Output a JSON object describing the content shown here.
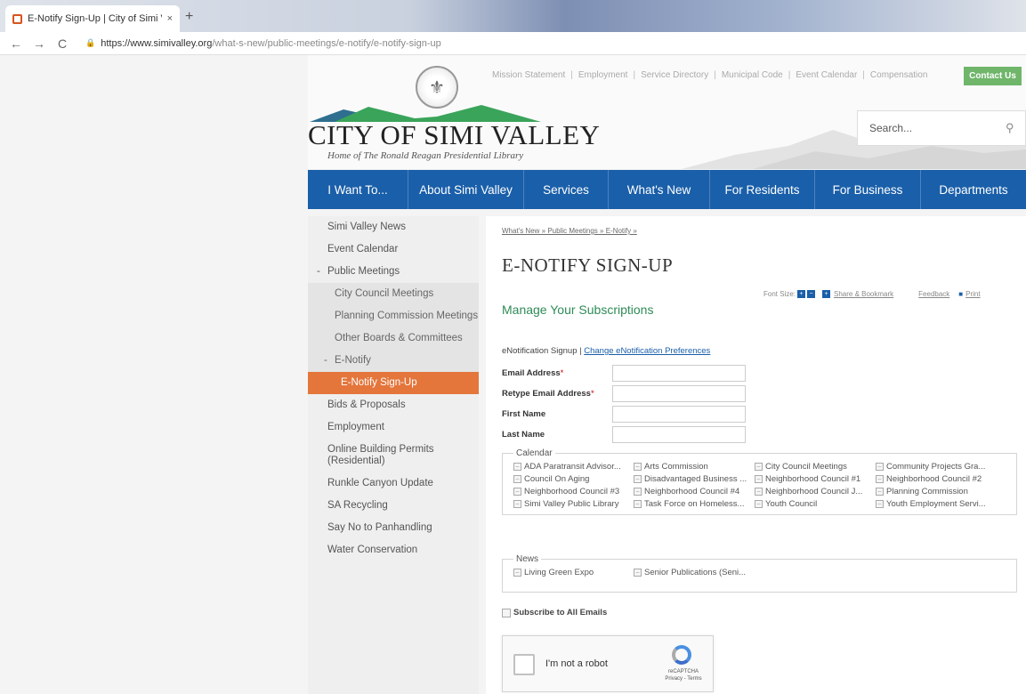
{
  "browser": {
    "tab_title": "E-Notify Sign-Up | City of Simi Va",
    "tab_close": "×",
    "new_tab": "+",
    "back": "←",
    "forward": "→",
    "reload": "C",
    "url_host": "https://www.simivalley.org",
    "url_path": "/what-s-new/public-meetings/e-notify/e-notify-sign-up"
  },
  "header": {
    "title": "CITY OF SIMI VALLEY",
    "tagline": "Home of The Ronald Reagan Presidential Library",
    "utility_links": [
      "Mission Statement",
      "Employment",
      "Service Directory",
      "Municipal Code",
      "Event Calendar",
      "Compensation"
    ],
    "contact_label": "Contact Us",
    "search_placeholder": "Search..."
  },
  "nav": {
    "items": [
      "I Want To...",
      "About Simi Valley",
      "Services",
      "What's New",
      "For Residents",
      "For Business",
      "Departments"
    ]
  },
  "sidebar": {
    "items": [
      {
        "label": "Simi Valley News"
      },
      {
        "label": "Event Calendar"
      },
      {
        "label": "Public Meetings"
      },
      {
        "label": "City Council Meetings"
      },
      {
        "label": "Planning Commission Meetings"
      },
      {
        "label": "Other Boards & Committees"
      },
      {
        "label": "E-Notify"
      },
      {
        "label": "E-Notify Sign-Up"
      },
      {
        "label": "Bids & Proposals"
      },
      {
        "label": "Employment"
      },
      {
        "label": "Online Building Permits (Residential)"
      },
      {
        "label": "Runkle Canyon Update"
      },
      {
        "label": "SA Recycling"
      },
      {
        "label": "Say No to Panhandling"
      },
      {
        "label": "Water Conservation"
      }
    ]
  },
  "content": {
    "breadcrumb": "What's New » Public Meetings » E-Notify »",
    "title": "E-NOTIFY SIGN-UP",
    "font_size_label": "Font Size:",
    "share_label": "Share & Bookmark",
    "feedback_label": "Feedback",
    "print_label": "Print",
    "subheading": "Manage Your Subscriptions",
    "signup_text": "eNotification Signup |",
    "pref_link": "Change eNotification Preferences",
    "fields": {
      "email": "Email Address",
      "retype": "Retype Email Address",
      "first": "First Name",
      "last": "Last Name",
      "required": "*"
    },
    "calendar_legend": "Calendar",
    "calendar_items": [
      "ADA Paratransit Advisor...",
      "Arts Commission",
      "City Council Meetings",
      "Community Projects Gra...",
      "Council On Aging",
      "Disadvantaged Business ...",
      "Neighborhood Council #1",
      "Neighborhood Council #2",
      "Neighborhood Council #3",
      "Neighborhood Council #4",
      "Neighborhood Council J...",
      "Planning Commission",
      "Simi Valley Public Library",
      "Task Force on Homeless...",
      "Youth Council",
      "Youth Employment Servi..."
    ],
    "news_legend": "News",
    "news_items": [
      "Living Green Expo",
      "Senior Publications (Seni..."
    ],
    "subscribe_all": "Subscribe to All Emails",
    "captcha_text": "I'm not a robot",
    "captcha_brand": "reCAPTCHA",
    "captcha_terms": "Privacy - Terms"
  }
}
